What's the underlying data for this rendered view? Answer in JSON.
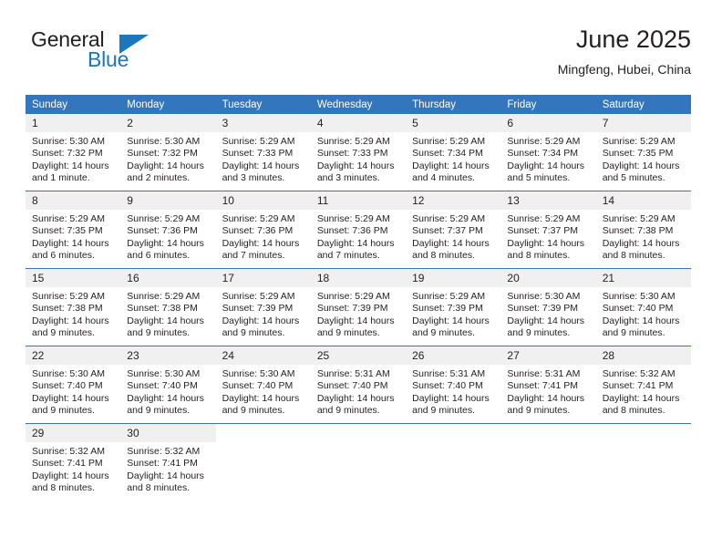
{
  "logo": {
    "word1": "General",
    "word2": "Blue",
    "brand_color": "#1b76bc"
  },
  "header": {
    "title": "June 2025",
    "subtitle": "Mingfeng, Hubei, China",
    "header_bg": "#3476bd",
    "daynum_bg": "#f0f0f0"
  },
  "weekdays": [
    "Sunday",
    "Monday",
    "Tuesday",
    "Wednesday",
    "Thursday",
    "Friday",
    "Saturday"
  ],
  "labels": {
    "sunrise_prefix": "Sunrise:",
    "sunset_prefix": "Sunset:",
    "daylight_prefix": "Daylight:"
  },
  "weeks": [
    [
      {
        "day": "1",
        "sunrise": "Sunrise: 5:30 AM",
        "sunset": "Sunset: 7:32 PM",
        "daylight1": "Daylight: 14 hours",
        "daylight2": "and 1 minute."
      },
      {
        "day": "2",
        "sunrise": "Sunrise: 5:30 AM",
        "sunset": "Sunset: 7:32 PM",
        "daylight1": "Daylight: 14 hours",
        "daylight2": "and 2 minutes."
      },
      {
        "day": "3",
        "sunrise": "Sunrise: 5:29 AM",
        "sunset": "Sunset: 7:33 PM",
        "daylight1": "Daylight: 14 hours",
        "daylight2": "and 3 minutes."
      },
      {
        "day": "4",
        "sunrise": "Sunrise: 5:29 AM",
        "sunset": "Sunset: 7:33 PM",
        "daylight1": "Daylight: 14 hours",
        "daylight2": "and 3 minutes."
      },
      {
        "day": "5",
        "sunrise": "Sunrise: 5:29 AM",
        "sunset": "Sunset: 7:34 PM",
        "daylight1": "Daylight: 14 hours",
        "daylight2": "and 4 minutes."
      },
      {
        "day": "6",
        "sunrise": "Sunrise: 5:29 AM",
        "sunset": "Sunset: 7:34 PM",
        "daylight1": "Daylight: 14 hours",
        "daylight2": "and 5 minutes."
      },
      {
        "day": "7",
        "sunrise": "Sunrise: 5:29 AM",
        "sunset": "Sunset: 7:35 PM",
        "daylight1": "Daylight: 14 hours",
        "daylight2": "and 5 minutes."
      }
    ],
    [
      {
        "day": "8",
        "sunrise": "Sunrise: 5:29 AM",
        "sunset": "Sunset: 7:35 PM",
        "daylight1": "Daylight: 14 hours",
        "daylight2": "and 6 minutes."
      },
      {
        "day": "9",
        "sunrise": "Sunrise: 5:29 AM",
        "sunset": "Sunset: 7:36 PM",
        "daylight1": "Daylight: 14 hours",
        "daylight2": "and 6 minutes."
      },
      {
        "day": "10",
        "sunrise": "Sunrise: 5:29 AM",
        "sunset": "Sunset: 7:36 PM",
        "daylight1": "Daylight: 14 hours",
        "daylight2": "and 7 minutes."
      },
      {
        "day": "11",
        "sunrise": "Sunrise: 5:29 AM",
        "sunset": "Sunset: 7:36 PM",
        "daylight1": "Daylight: 14 hours",
        "daylight2": "and 7 minutes."
      },
      {
        "day": "12",
        "sunrise": "Sunrise: 5:29 AM",
        "sunset": "Sunset: 7:37 PM",
        "daylight1": "Daylight: 14 hours",
        "daylight2": "and 8 minutes."
      },
      {
        "day": "13",
        "sunrise": "Sunrise: 5:29 AM",
        "sunset": "Sunset: 7:37 PM",
        "daylight1": "Daylight: 14 hours",
        "daylight2": "and 8 minutes."
      },
      {
        "day": "14",
        "sunrise": "Sunrise: 5:29 AM",
        "sunset": "Sunset: 7:38 PM",
        "daylight1": "Daylight: 14 hours",
        "daylight2": "and 8 minutes."
      }
    ],
    [
      {
        "day": "15",
        "sunrise": "Sunrise: 5:29 AM",
        "sunset": "Sunset: 7:38 PM",
        "daylight1": "Daylight: 14 hours",
        "daylight2": "and 9 minutes."
      },
      {
        "day": "16",
        "sunrise": "Sunrise: 5:29 AM",
        "sunset": "Sunset: 7:38 PM",
        "daylight1": "Daylight: 14 hours",
        "daylight2": "and 9 minutes."
      },
      {
        "day": "17",
        "sunrise": "Sunrise: 5:29 AM",
        "sunset": "Sunset: 7:39 PM",
        "daylight1": "Daylight: 14 hours",
        "daylight2": "and 9 minutes."
      },
      {
        "day": "18",
        "sunrise": "Sunrise: 5:29 AM",
        "sunset": "Sunset: 7:39 PM",
        "daylight1": "Daylight: 14 hours",
        "daylight2": "and 9 minutes."
      },
      {
        "day": "19",
        "sunrise": "Sunrise: 5:29 AM",
        "sunset": "Sunset: 7:39 PM",
        "daylight1": "Daylight: 14 hours",
        "daylight2": "and 9 minutes."
      },
      {
        "day": "20",
        "sunrise": "Sunrise: 5:30 AM",
        "sunset": "Sunset: 7:39 PM",
        "daylight1": "Daylight: 14 hours",
        "daylight2": "and 9 minutes."
      },
      {
        "day": "21",
        "sunrise": "Sunrise: 5:30 AM",
        "sunset": "Sunset: 7:40 PM",
        "daylight1": "Daylight: 14 hours",
        "daylight2": "and 9 minutes."
      }
    ],
    [
      {
        "day": "22",
        "sunrise": "Sunrise: 5:30 AM",
        "sunset": "Sunset: 7:40 PM",
        "daylight1": "Daylight: 14 hours",
        "daylight2": "and 9 minutes."
      },
      {
        "day": "23",
        "sunrise": "Sunrise: 5:30 AM",
        "sunset": "Sunset: 7:40 PM",
        "daylight1": "Daylight: 14 hours",
        "daylight2": "and 9 minutes."
      },
      {
        "day": "24",
        "sunrise": "Sunrise: 5:30 AM",
        "sunset": "Sunset: 7:40 PM",
        "daylight1": "Daylight: 14 hours",
        "daylight2": "and 9 minutes."
      },
      {
        "day": "25",
        "sunrise": "Sunrise: 5:31 AM",
        "sunset": "Sunset: 7:40 PM",
        "daylight1": "Daylight: 14 hours",
        "daylight2": "and 9 minutes."
      },
      {
        "day": "26",
        "sunrise": "Sunrise: 5:31 AM",
        "sunset": "Sunset: 7:40 PM",
        "daylight1": "Daylight: 14 hours",
        "daylight2": "and 9 minutes."
      },
      {
        "day": "27",
        "sunrise": "Sunrise: 5:31 AM",
        "sunset": "Sunset: 7:41 PM",
        "daylight1": "Daylight: 14 hours",
        "daylight2": "and 9 minutes."
      },
      {
        "day": "28",
        "sunrise": "Sunrise: 5:32 AM",
        "sunset": "Sunset: 7:41 PM",
        "daylight1": "Daylight: 14 hours",
        "daylight2": "and 8 minutes."
      }
    ],
    [
      {
        "day": "29",
        "sunrise": "Sunrise: 5:32 AM",
        "sunset": "Sunset: 7:41 PM",
        "daylight1": "Daylight: 14 hours",
        "daylight2": "and 8 minutes."
      },
      {
        "day": "30",
        "sunrise": "Sunrise: 5:32 AM",
        "sunset": "Sunset: 7:41 PM",
        "daylight1": "Daylight: 14 hours",
        "daylight2": "and 8 minutes."
      },
      {
        "day": "",
        "sunrise": "",
        "sunset": "",
        "daylight1": "",
        "daylight2": "",
        "blank": true
      },
      {
        "day": "",
        "sunrise": "",
        "sunset": "",
        "daylight1": "",
        "daylight2": "",
        "blank": true
      },
      {
        "day": "",
        "sunrise": "",
        "sunset": "",
        "daylight1": "",
        "daylight2": "",
        "blank": true
      },
      {
        "day": "",
        "sunrise": "",
        "sunset": "",
        "daylight1": "",
        "daylight2": "",
        "blank": true
      },
      {
        "day": "",
        "sunrise": "",
        "sunset": "",
        "daylight1": "",
        "daylight2": "",
        "blank": true
      }
    ]
  ]
}
